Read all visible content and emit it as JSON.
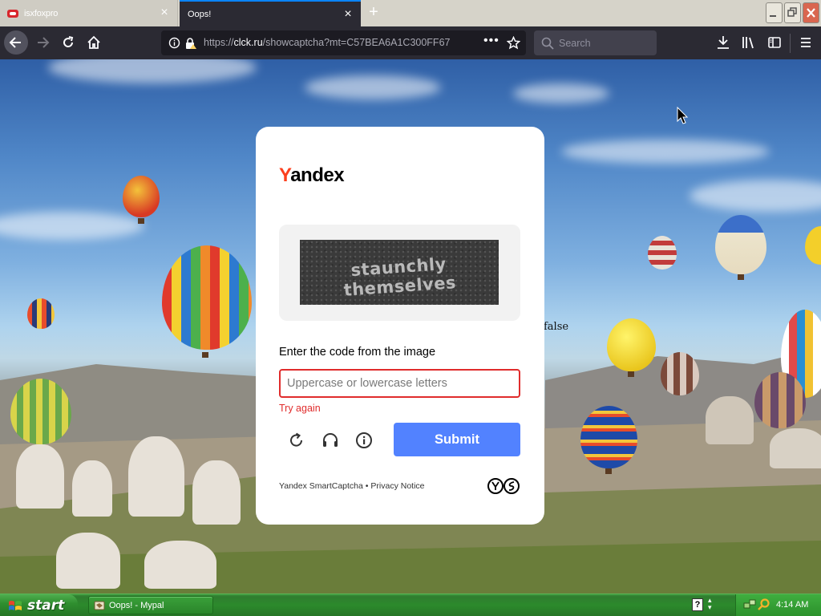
{
  "browser": {
    "tabs": [
      {
        "label": "isxfoxpro",
        "close": "×",
        "active": false
      },
      {
        "label": "Oops!",
        "close": "×",
        "active": true
      }
    ],
    "new_tab": "+",
    "url": {
      "prefix": "https://",
      "domain": "clck.ru",
      "path": "/showcaptcha?mt=C57BEA6A1C300FF67"
    },
    "url_more": "•••",
    "search_placeholder": "Search",
    "icons": [
      "back-arrow-icon",
      "forward-arrow-icon",
      "reload-icon",
      "home-icon",
      "info-icon",
      "lock-warning-icon",
      "bookmark-star-icon",
      "search-icon",
      "download-icon",
      "library-icon",
      "sidebar-icon",
      "hamburger-menu-icon"
    ]
  },
  "captcha": {
    "logo_first": "Y",
    "logo_rest": "andex",
    "image_text": "staunchly themselves",
    "instruction": "Enter the code from the image",
    "input_placeholder": "Uppercase or lowercase letters",
    "input_value": "",
    "error": "Try again",
    "submit": "Submit",
    "footer_brand": "Yandex SmartCaptcha",
    "footer_separator": " • ",
    "footer_privacy": "Privacy Notice",
    "colors": {
      "brand_red": "#fc3f1d",
      "submit_blue": "#5282ff",
      "error_red": "#e02c2c"
    }
  },
  "page": {
    "stray_text": "false"
  },
  "taskbar": {
    "start": "start",
    "task_label": "Oops! - Mypal",
    "help_icon": "?",
    "clock": "4:14 AM"
  }
}
